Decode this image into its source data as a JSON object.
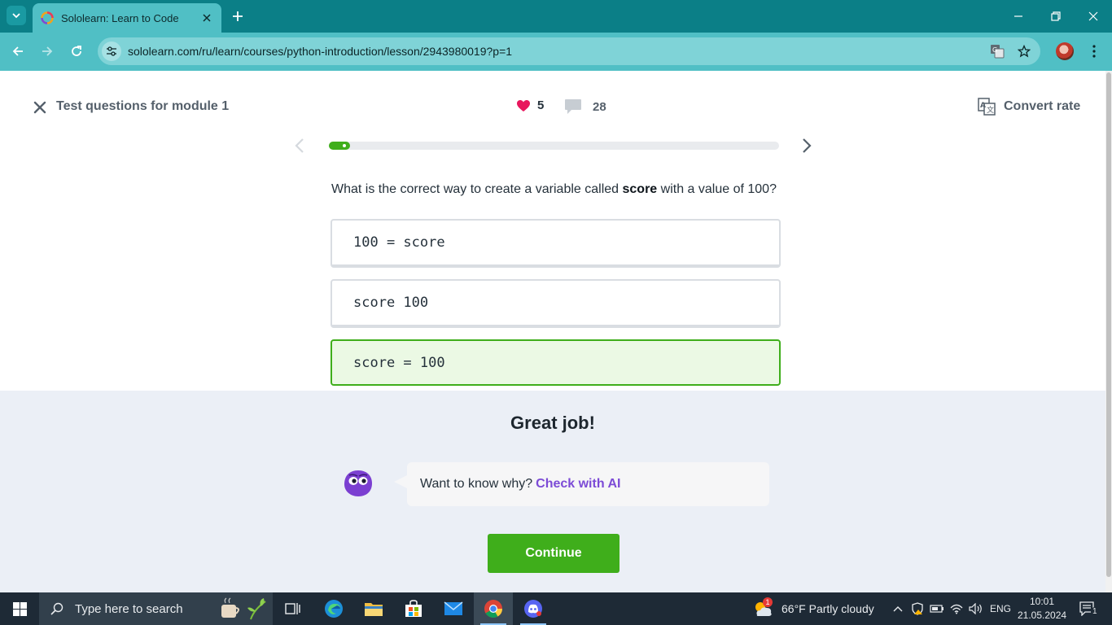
{
  "browser": {
    "tab_title": "Sololearn: Learn to Code",
    "url": "sololearn.com/ru/learn/courses/python-introduction/lesson/2943980019?p=1"
  },
  "header": {
    "lesson_title": "Test questions for module 1",
    "hearts": "5",
    "comments": "28",
    "convert_label": "Convert rate"
  },
  "progress": {
    "fraction": 0.047
  },
  "question": {
    "prefix": "What is the correct way to create a variable called ",
    "keyword": "score",
    "suffix": " with a value of 100?"
  },
  "options": [
    {
      "code": "100 = score",
      "state": "default"
    },
    {
      "code": "score 100",
      "state": "default"
    },
    {
      "code": "score = 100",
      "state": "correct"
    }
  ],
  "feedback": {
    "title": "Great job!",
    "prompt": "Want to know why?",
    "ai_link": "Check with AI",
    "continue_label": "Continue"
  },
  "taskbar": {
    "search_placeholder": "Type here to search",
    "weather_badge": "1",
    "weather": "66°F  Partly cloudy",
    "language": "ENG",
    "time": "10:01",
    "date": "21.05.2024",
    "notification_count": "1"
  },
  "colors": {
    "chrome_tabbar": "#0b7f87",
    "chrome_toolbar": "#50bfc5",
    "accent_green": "#3fae1b",
    "ai_purple": "#7c4bd6",
    "heart_red": "#e8175d",
    "feedback_bg": "#ebeff6"
  },
  "icons": {
    "tab_search": "chevron-down-icon",
    "close": "close-icon",
    "heart": "heart-icon",
    "comment": "comment-icon",
    "translate": "translate-icon",
    "prev": "chevron-left-icon",
    "next": "chevron-right-icon"
  }
}
